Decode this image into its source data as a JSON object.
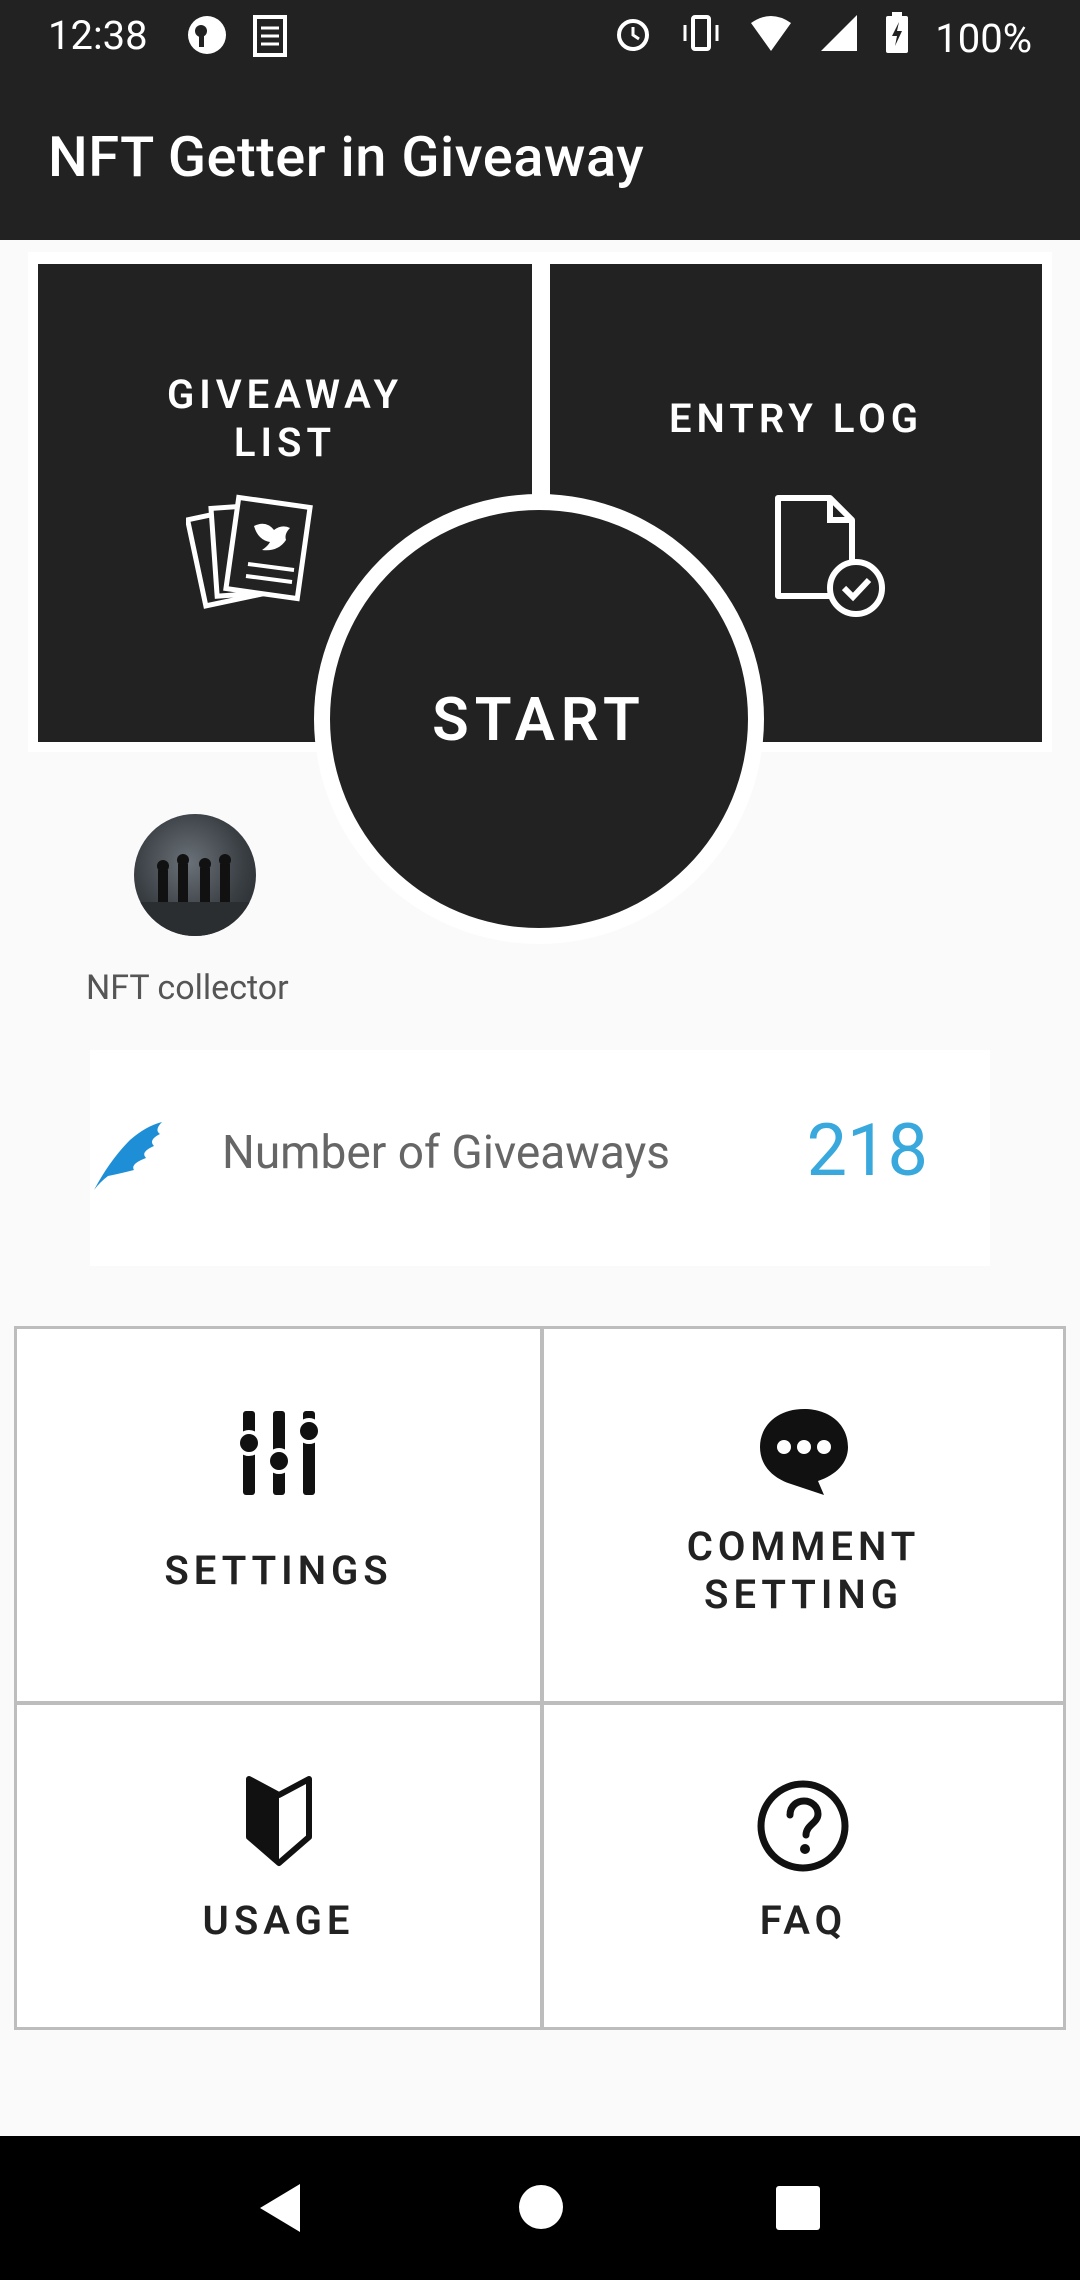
{
  "status_bar": {
    "time": "12:38",
    "battery": "100%",
    "icons": [
      "app-logo-icon",
      "notepad-icon",
      "alarm-icon",
      "vibrate-icon",
      "wifi-icon",
      "signal-icon",
      "battery-charging-icon"
    ]
  },
  "app_bar": {
    "title": "NFT Getter in Giveaway"
  },
  "top_tiles": {
    "giveaway_list": {
      "line1": "GIVEAWAY",
      "line2": "LIST"
    },
    "entry_log": {
      "label": "ENTRY LOG"
    },
    "start": {
      "label": "START"
    }
  },
  "profile": {
    "name": "NFT collector"
  },
  "stats": {
    "label": "Number of Giveaways",
    "value": "218",
    "value_color": "#39a8dc",
    "icon": "feather-icon"
  },
  "menu": {
    "settings": {
      "label": "SETTINGS"
    },
    "comment_setting": {
      "line1": "COMMENT",
      "line2": "SETTING"
    },
    "usage": {
      "label": "USAGE"
    },
    "faq": {
      "label": "FAQ"
    }
  },
  "nav": {
    "back": "back",
    "home": "home",
    "recents": "recents"
  }
}
